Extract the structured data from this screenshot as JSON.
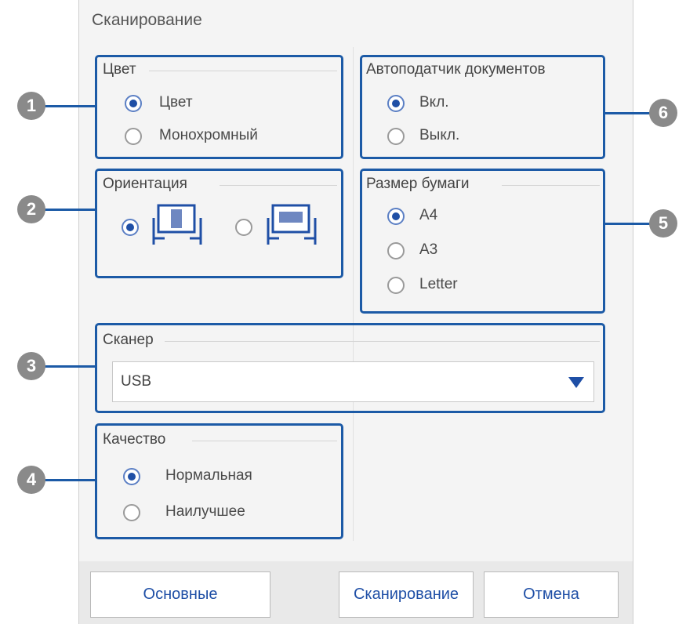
{
  "dialog": {
    "title": "Сканирование"
  },
  "groups": {
    "color": {
      "legend": "Цвет",
      "options": [
        "Цвет",
        "Монохромный"
      ],
      "selected": 0
    },
    "orientation": {
      "legend": "Ориентация",
      "options": [
        "portrait-icon",
        "landscape-icon"
      ],
      "selected": 0
    },
    "scanner": {
      "legend": "Сканер",
      "value": "USB"
    },
    "quality": {
      "legend": "Качество",
      "options": [
        "Нормальная",
        "Наилучшее"
      ],
      "selected": 0
    },
    "feeder": {
      "legend": "Автоподатчик документов",
      "options": [
        "Вкл.",
        "Выкл."
      ],
      "selected": 0
    },
    "paper": {
      "legend": "Размер бумаги",
      "options": [
        "A4",
        "A3",
        "Letter"
      ],
      "selected": 0
    }
  },
  "callouts": [
    "1",
    "2",
    "3",
    "4",
    "5",
    "6"
  ],
  "buttons": {
    "basic": "Основные",
    "scan": "Сканирование",
    "cancel": "Отмена"
  },
  "colors": {
    "accent": "#1c5aa6",
    "badge": "#8a8a8a",
    "dialog_bg": "#f4f4f4"
  }
}
